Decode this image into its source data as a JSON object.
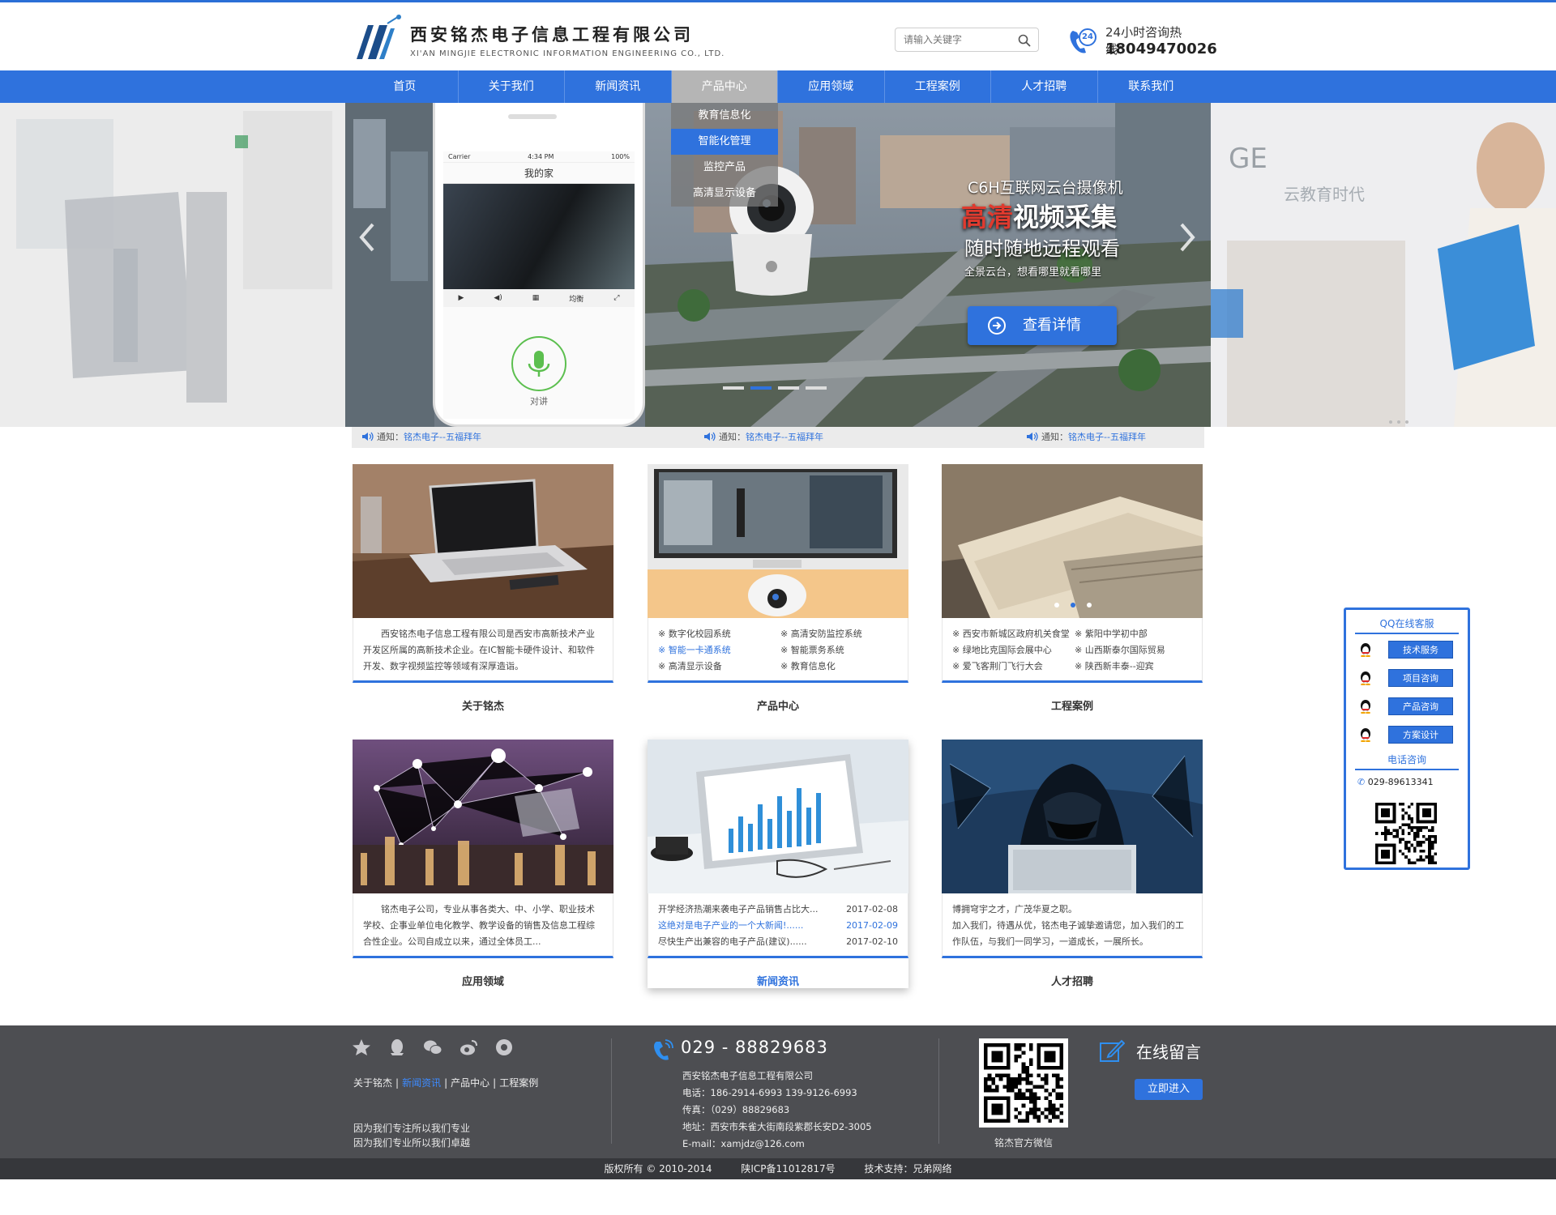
{
  "header": {
    "company_cn": "西安铭杰电子信息工程有限公司",
    "company_en": "XI'AN MINGJIE ELECTRONIC INFORMATION ENGINEERING CO., LTD.",
    "search_placeholder": "请输入关键字",
    "hotline_label": "24小时咨询热线：",
    "hotline_number": "18049470026",
    "hotline_badge": "24"
  },
  "nav": {
    "items": [
      "首页",
      "关于我们",
      "新闻资讯",
      "产品中心",
      "应用领域",
      "工程案例",
      "人才招聘",
      "联系我们"
    ],
    "active": "产品中心",
    "submenu": [
      "教育信息化",
      "智能化管理",
      "监控产品",
      "高清显示设备"
    ],
    "submenu_active": "智能化管理"
  },
  "banner": {
    "phone_carrier": "Carrier",
    "phone_time": "4:34 PM",
    "phone_battery": "100%",
    "phone_title": "我的家",
    "phone_mode": "均衡",
    "phone_talk": "对讲",
    "title": "C6H互联网云台摄像机",
    "headline_red": "高清",
    "headline_rest": "视频采集",
    "subline": "随时随地远程观看",
    "small": "全景云台，想看哪里就看哪里",
    "button": "查看详情",
    "right_text_1": "GE",
    "right_text_2": "云教育时代",
    "dots": 4,
    "active_dot": 1
  },
  "notices": [
    {
      "label": "通知：",
      "link": "铭杰电子--五福拜年"
    },
    {
      "label": "通知：",
      "link": "铭杰电子--五福拜年"
    },
    {
      "label": "通知：",
      "link": "铭杰电子--五福拜年"
    }
  ],
  "cards": {
    "about": {
      "title": "关于铭杰",
      "text": "西安铭杰电子信息工程有限公司是西安市高新技术产业开发区所属的高新技术企业。在IC智能卡硬件设计、和软件开发、数字视频监控等领域有深厚造诣。"
    },
    "products": {
      "title": "产品中心",
      "items": [
        "数字化校园系统",
        "高清安防监控系统",
        "智能一卡通系统",
        "智能票务系统",
        "高清显示设备",
        "教育信息化"
      ],
      "highlight": "智能一卡通系统"
    },
    "cases": {
      "title": "工程案例",
      "items": [
        "西安市新城区政府机关食堂",
        "紫阳中学初中部",
        "绿地比克国际会展中心",
        "山西斯泰尔国际贸易",
        "爱飞客荆门飞行大会",
        "陕西新丰泰--迎宾"
      ]
    },
    "applications": {
      "title": "应用领域",
      "text": "铭杰电子公司，专业从事各类大、中、小学、职业技术学校、企事业单位电化教学、教学设备的销售及信息工程综合性企业。公司自成立以来，通过全体员工..."
    },
    "news": {
      "title": "新闻资讯",
      "items": [
        {
          "title": "开学经济热潮来袭电子产品销售占比大...",
          "date": "2017-02-08"
        },
        {
          "title": "这绝对是电子产业的一个大新闻!......",
          "date": "2017-02-09"
        },
        {
          "title": "尽快生产出兼容的电子产品(建议)......",
          "date": "2017-02-10"
        }
      ]
    },
    "jobs": {
      "title": "人才招聘",
      "line1": "博拥穹宇之才，广茂华夏之职。",
      "line2": "加入我们，待遇从优，铭杰电子诚挚邀请您，加入我们的工作队伍，与我们一同学习，一道成长，一展所长。"
    }
  },
  "qq": {
    "title": "QQ在线客服",
    "buttons": [
      "技术服务",
      "项目咨询",
      "产品咨询",
      "方案设计"
    ],
    "phone_title": "电话咨询",
    "phone": "029-89613341"
  },
  "footer": {
    "links": [
      "关于铭杰",
      "新闻资讯",
      "产品中心",
      "工程案例"
    ],
    "current_link": "新闻资讯",
    "slogan1": "因为我们专注所以我们专业",
    "slogan2": "因为我们专业所以我们卓越",
    "phone": "029 - 88829683",
    "company": "西安铭杰电子信息工程有限公司",
    "tel": "电话：186-2914-6993 139-9126-6993",
    "fax": "传真：（029）88829683",
    "address": "地址：西安市朱雀大街南段紫郡长安D2-3005",
    "email": "E-mail：xamjdz@126.com",
    "qr_label": "铭杰官方微信",
    "message": "在线留言",
    "enter": "立即进入",
    "copyright": "版权所有 © 2010-2014",
    "icp": "陕ICP备11012817号",
    "support": "技术支持：兄弟网络"
  },
  "colors": {
    "brand_blue": "#2f72dd",
    "footer_bg": "#4d4e52",
    "copyright_bg": "#36373b"
  }
}
